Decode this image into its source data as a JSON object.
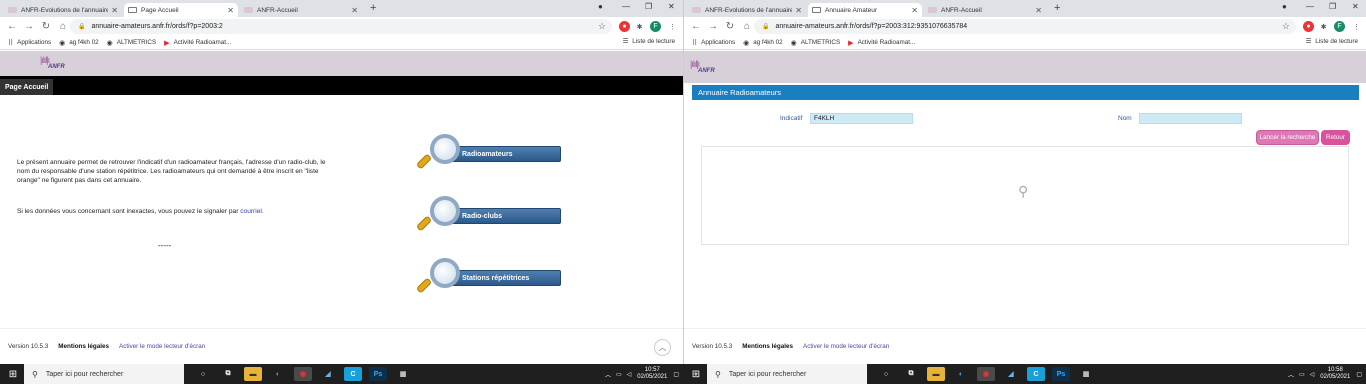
{
  "left": {
    "tabs": [
      "ANFR-Evolutions de l'annuaire d",
      "Page Accueil",
      "ANFR-Accueil"
    ],
    "url": "annuaire-amateurs.anfr.fr/ords/f?p=2003:2",
    "bookmarks": [
      "Applications",
      "ag f4kh 02",
      "ALTMETRICS",
      "Activité Radioamat..."
    ],
    "reading_list": "Liste de lecture",
    "logo_text": "ANFR",
    "page_tab": "Page Accueil",
    "intro": "Le présent annuaire permet de retrouver l'indicatif d'un radioamateur français, l'adresse d'un radio-club, le nom du responsable d'une station répétitrice. Les radioamateurs qui ont demandé à être inscrit en \"liste orange\" ne figurent pas dans cet annuaire.",
    "report_text": "Si les données vous concernant sont inexactes, vous pouvez le signaler par",
    "report_link": "courriel.",
    "separator": "-----",
    "buttons": [
      "Radioamateurs",
      "Radio-clubs",
      "Stations répétitrices"
    ],
    "footer": {
      "version": "Version 10.5.3",
      "legal": "Mentions légales",
      "accessibility": "Activer le mode lecteur d'écran"
    }
  },
  "right": {
    "tabs": [
      "ANFR-Evolutions de l'annuaire d",
      "Annuaire Amateur",
      "ANFR-Accueil"
    ],
    "url": "annuaire-amateurs.anfr.fr/ords/f?p=2003:312:9351076635784",
    "bookmarks": [
      "Applications",
      "ag f4kh 02",
      "ALTMETRICS",
      "Activité Radioamat..."
    ],
    "reading_list": "Liste de lecture",
    "logo_text": "ANFR",
    "panel_title": "Annuaire Radioamateurs",
    "indicatif_label": "Indicatif",
    "indicatif_value": "F4KLH",
    "nom_label": "Nom",
    "nom_value": "",
    "search_button": "Lancer la recherche",
    "back_button": "Retour",
    "footer": {
      "version": "Version 10.5.3",
      "legal": "Mentions légales",
      "accessibility": "Activer le mode lecteur d'écran"
    }
  },
  "taskbar": {
    "search_placeholder": "Taper ici pour rechercher",
    "left_time": "10:57",
    "left_date": "02/05/2021",
    "right_time": "10:58",
    "right_date": "02/05/2021"
  },
  "colors": {
    "panel_header": "#1a7fc1",
    "pink_button": "#d9539c",
    "input_bg": "#cdeaf5",
    "nav_button": "#2b5a8a"
  }
}
